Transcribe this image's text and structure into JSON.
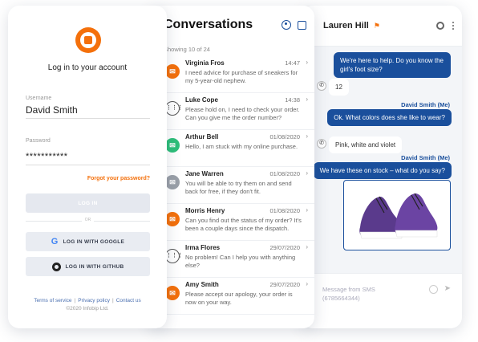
{
  "colors": {
    "accent": "#f4700b",
    "brand_blue": "#1a4f9c",
    "green": "#2dbf7a",
    "grey": "#9aa0a8"
  },
  "login": {
    "title": "Log in to your account",
    "username_label": "Username",
    "username_value": "David Smith",
    "password_label": "Password",
    "password_value": "***********",
    "forgot_label": "Forgot your password?",
    "login_button": "LOG IN",
    "or_label": "OR",
    "google_button": "LOG IN WITH GOOGLE",
    "github_button": "LOG IN WITH GITHUB",
    "footer_links": [
      "Terms of service",
      "Privacy policy",
      "Contact us"
    ],
    "copyright": "©2020 Infobip Ltd."
  },
  "conversations": {
    "title": "Conversations",
    "count_label": "Showing 10 of 24",
    "items": [
      {
        "name": "Virginia Fros",
        "date": "14:47",
        "text": "I need advice for purchase of sneakers for my 5-year-old nephew.",
        "avatar": "orange"
      },
      {
        "name": "Luke Cope",
        "date": "14:38",
        "text": "Please hold on, I need to check your order. Can you give me the order number?",
        "avatar": "dial"
      },
      {
        "name": "Arthur Bell",
        "date": "01/08/2020",
        "text": "Hello, I am stuck with my online purchase.",
        "avatar": "green"
      },
      {
        "name": "Jane Warren",
        "date": "01/08/2020",
        "text": "You will be able to try them on and send back for free, if they don't fit.",
        "avatar": "grey"
      },
      {
        "name": "Morris Henry",
        "date": "01/08/2020",
        "text": "Can you find out the status of my order? It's been a couple days since the dispatch.",
        "avatar": "orange"
      },
      {
        "name": "Irma Flores",
        "date": "29/07/2020",
        "text": "No problem! Can I help you with anything else?",
        "avatar": "dial"
      },
      {
        "name": "Amy Smith",
        "date": "29/07/2020",
        "text": "Please accept our apology, your order is now on your way.",
        "avatar": "orange"
      }
    ]
  },
  "chat": {
    "contact_name": "Lauren Hill",
    "messages": [
      {
        "dir": "out",
        "text": "We're here to help. Do you know the girl's foot size?"
      },
      {
        "dir": "in",
        "text": "12"
      },
      {
        "dir": "out",
        "sender": "David Smith (Me)",
        "text": "Ok. What colors does she like to wear?"
      },
      {
        "dir": "in",
        "text": "Pink, white and violet"
      },
      {
        "dir": "out",
        "sender": "David Smith (Me)",
        "text": "We have these on stock – what do you say?"
      }
    ],
    "compose_placeholder": "Message from SMS",
    "compose_number": "(6785664344)"
  }
}
